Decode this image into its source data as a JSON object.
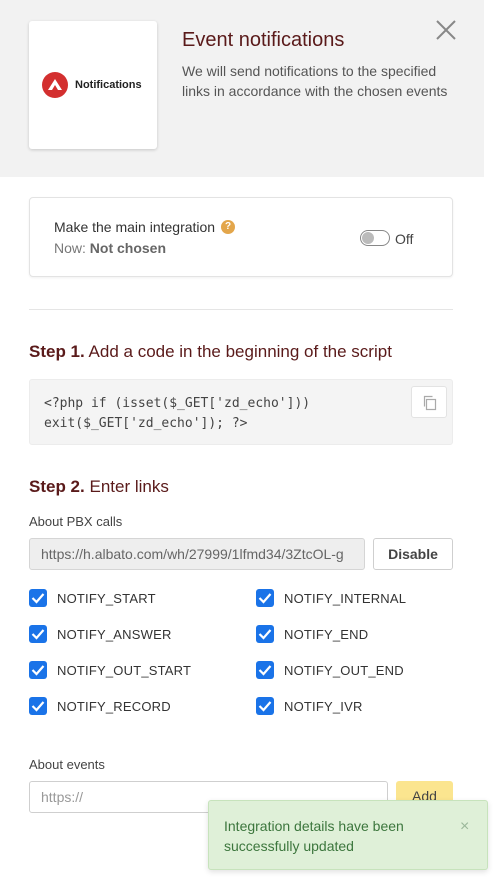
{
  "header": {
    "logo_text": "Notifications",
    "title": "Event notifications",
    "description": "We will send notifications to the specified links in accordance with the chosen events"
  },
  "main_integration": {
    "title": "Make the main integration",
    "now_label": "Now:",
    "now_value": "Not chosen",
    "toggle_state": "Off"
  },
  "step1": {
    "number": "Step 1.",
    "title": "Add a code in the beginning of the script",
    "code": "<?php if (isset($_GET['zd_echo']))\nexit($_GET['zd_echo']); ?>"
  },
  "step2": {
    "number": "Step 2.",
    "title": "Enter links",
    "pbx_label": "About PBX calls",
    "pbx_url": "https://h.albato.com/wh/27999/1lfmd34/3ZtcOL-g",
    "disable_label": "Disable",
    "checkboxes": [
      {
        "label": "NOTIFY_START",
        "checked": true
      },
      {
        "label": "NOTIFY_INTERNAL",
        "checked": true
      },
      {
        "label": "NOTIFY_ANSWER",
        "checked": true
      },
      {
        "label": "NOTIFY_END",
        "checked": true
      },
      {
        "label": "NOTIFY_OUT_START",
        "checked": true
      },
      {
        "label": "NOTIFY_OUT_END",
        "checked": true
      },
      {
        "label": "NOTIFY_RECORD",
        "checked": true
      },
      {
        "label": "NOTIFY_IVR",
        "checked": true
      }
    ],
    "events_label": "About events",
    "events_placeholder": "https://",
    "add_label": "Add"
  },
  "toast": {
    "message": "Integration details have been successfully updated",
    "close_symbol": "×"
  },
  "colors": {
    "heading": "#5a1a1a",
    "checkbox": "#1a73e8",
    "add_button": "#fbe58f",
    "toast_bg": "#dff0d8",
    "toast_text": "#3c763d",
    "help_icon": "#e3a64b"
  }
}
